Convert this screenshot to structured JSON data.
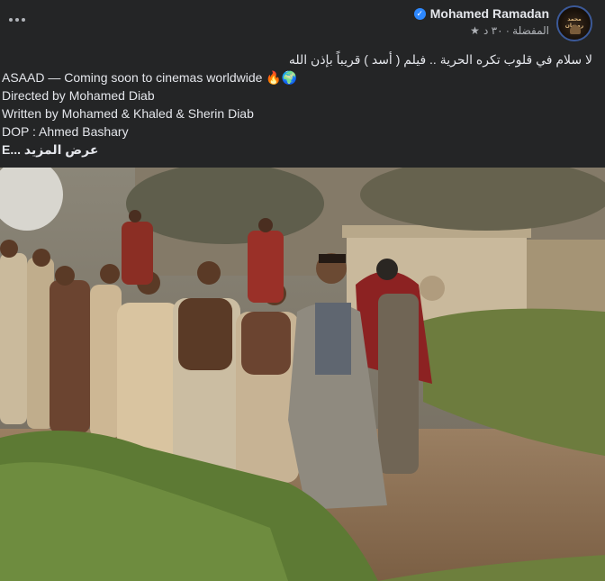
{
  "post": {
    "author": "Mohamed Ramadan",
    "meta_time": "المفضلة · ٣٠ د",
    "avatar_text": "محمد رمضان",
    "more_label": "More options",
    "lines": [
      "لا سلام في قلوب تكره الحرية .. فيلم ( أسد ) قريباً بإذن الله",
      "ASAAD — Coming soon to cinemas worldwide 🔥🌍",
      "Directed by Mohamed Diab",
      "Written by Mohamed & Khaled & Sherin Diab",
      "DOP : Ahmed Bashary"
    ],
    "see_more": "E... عرض المزيد"
  },
  "colors": {
    "background": "#242526",
    "text": "#e4e6eb",
    "secondary": "#b0b3b8",
    "verified": "#2d88ff"
  },
  "icons": [
    "more-horizontal-icon",
    "verified-badge-icon",
    "star-icon",
    "globe-icon"
  ]
}
